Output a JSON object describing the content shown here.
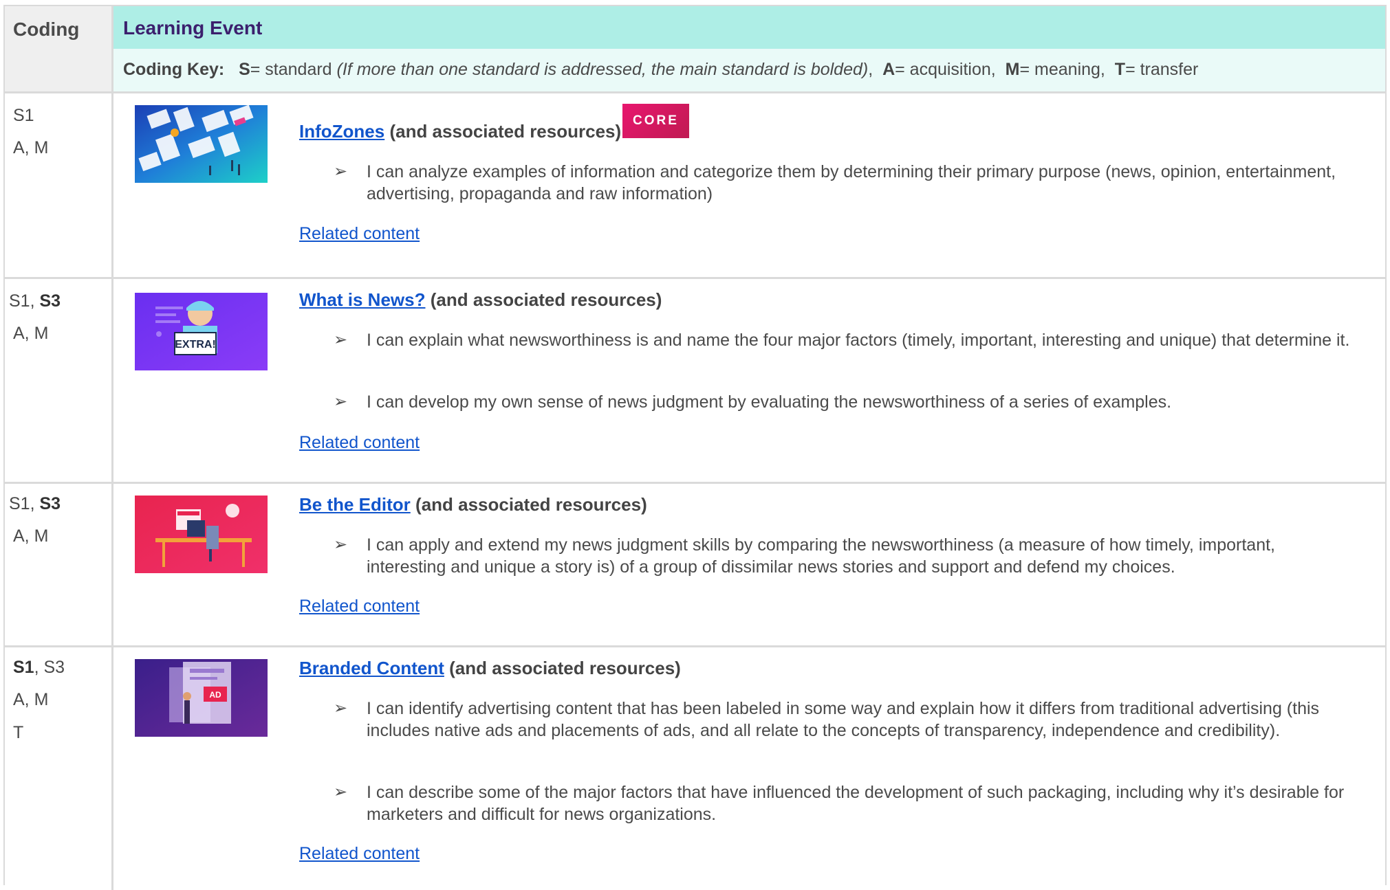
{
  "header": {
    "coding_label": "Coding",
    "event_label": "Learning Event",
    "key_prefix": "Coding Key:",
    "key_s": "S",
    "key_s_text": "= standard",
    "key_note": "(If more than one standard is addressed, the main standard is bolded)",
    "key_a": "A",
    "key_a_text": "= acquisition,",
    "key_m": "M",
    "key_m_text": "= meaning,",
    "key_t": "T",
    "key_t_text": "= transfer"
  },
  "rows": [
    {
      "standards_plain": "S1",
      "codes": "A, M",
      "title_link": "InfoZones",
      "title_rest": "(and associated resources)",
      "badge": "CORE",
      "bullets": [
        "I can analyze examples of information and categorize them by determining their primary purpose (news, opinion, entertainment, advertising, propaganda and raw information)"
      ],
      "related": "Related content",
      "thumb_icon": "infozones-collage-image"
    },
    {
      "standards_plain": "S1, ",
      "standards_bold": "S3",
      "codes": "A, M",
      "title_link": "What is News?",
      "title_rest": "(and associated resources)",
      "bullets": [
        "I can explain what newsworthiness is and name the four major factors (timely, important, interesting and unique) that determine it.",
        "I can develop my own sense of news judgment by evaluating the newsworthiness of a series of examples."
      ],
      "related": "Related content",
      "thumb_icon": "newsboy-extra-image",
      "thumb_text": "EXTRA!"
    },
    {
      "standards_plain": "S1, ",
      "standards_bold": "S3",
      "codes": "A, M",
      "title_link": "Be the Editor",
      "title_rest": "(and associated resources)",
      "bullets": [
        "I can apply and extend my news judgment skills by comparing the newsworthiness (a measure of how timely, important, interesting and unique a story is) of a group of dissimilar news stories and support and defend my choices."
      ],
      "related": "Related content",
      "thumb_icon": "editor-desk-image"
    },
    {
      "standards_bold": "S1",
      "standards_plain": ", S3",
      "codes": "A, M",
      "codes2": "T",
      "title_link": "Branded Content",
      "title_rest": "(and associated resources)",
      "bullets": [
        "I can identify advertising content that has been labeled in some way and explain how it differs from traditional advertising (this includes native ads and placements of ads, and all relate to the concepts of transparency, independence and credibility).",
        "I can describe some of the major factors that have influenced the development of such packaging, including why it’s desirable for marketers and difficult for news organizations."
      ],
      "related": "Related content",
      "thumb_icon": "branded-ad-image",
      "thumb_text": "AD"
    }
  ],
  "colors": {
    "header_teal": "#aeeee6",
    "key_bg": "#eafaf8",
    "title_purple": "#3b1f6d",
    "link_blue": "#1155cc",
    "core_badge": "#e0175f"
  }
}
